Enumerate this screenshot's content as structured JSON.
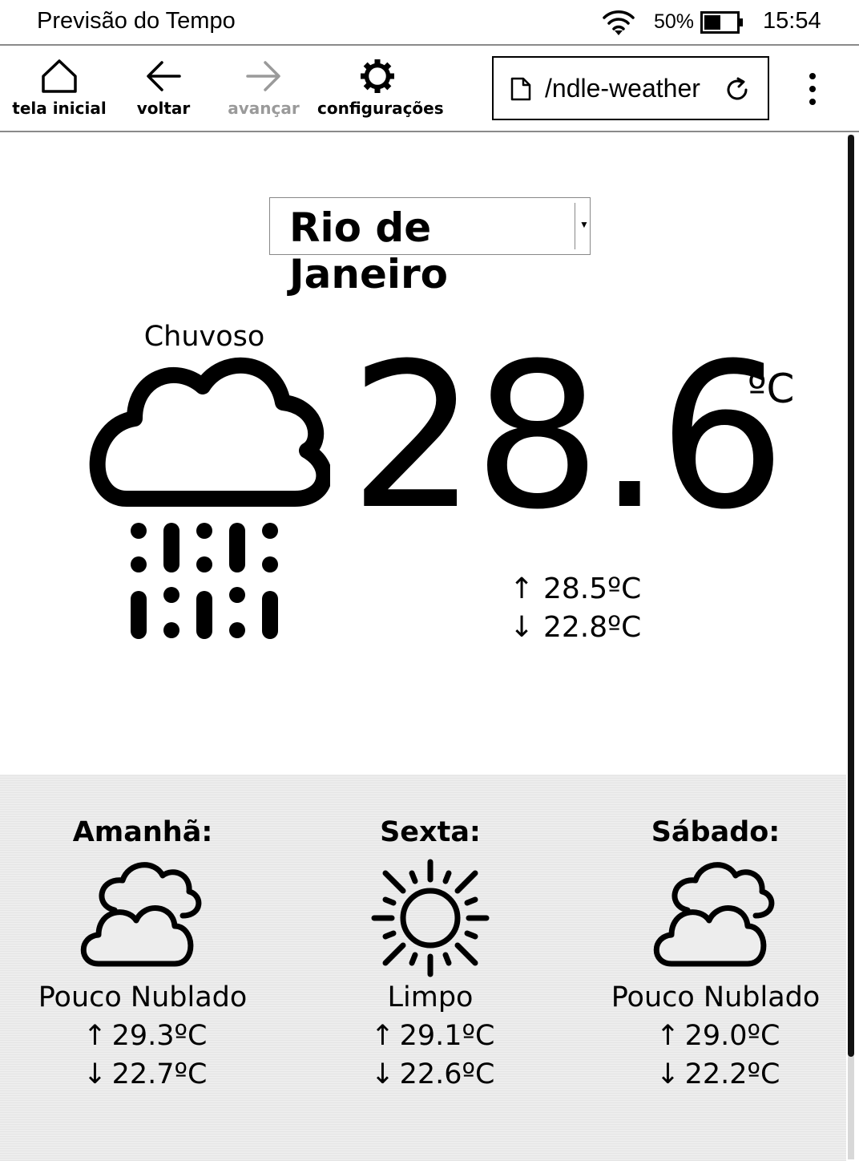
{
  "status_bar": {
    "title": "Previsão do Tempo",
    "battery_percent": "50%",
    "battery_level": 0.5,
    "time": "15:54"
  },
  "toolbar": {
    "home_label": "tela inicial",
    "back_label": "voltar",
    "forward_label": "avançar",
    "settings_label": "configurações",
    "url_text": "ndle-weather/"
  },
  "city": {
    "selected": "Rio de Janeiro"
  },
  "current": {
    "condition": "Chuvoso",
    "icon": "rain-cloud-icon",
    "temperature": "28.6",
    "unit": "ºC",
    "high_arrow": "↑",
    "high": "28.5ºC",
    "low_arrow": "↓",
    "low": "22.8ºC"
  },
  "forecast": [
    {
      "day": "Amanhã:",
      "icon": "partly-cloudy-icon",
      "condition": "Pouco Nublado",
      "high_arrow": "↑",
      "high": "29.3ºC",
      "low_arrow": "↓",
      "low": "22.7ºC"
    },
    {
      "day": "Sexta:",
      "icon": "sun-icon",
      "condition": "Limpo",
      "high_arrow": "↑",
      "high": "29.1ºC",
      "low_arrow": "↓",
      "low": "22.6ºC"
    },
    {
      "day": "Sábado:",
      "icon": "partly-cloudy-icon",
      "condition": "Pouco Nublado",
      "high_arrow": "↑",
      "high": "29.0ºC",
      "low_arrow": "↓",
      "low": "22.2ºC"
    }
  ]
}
